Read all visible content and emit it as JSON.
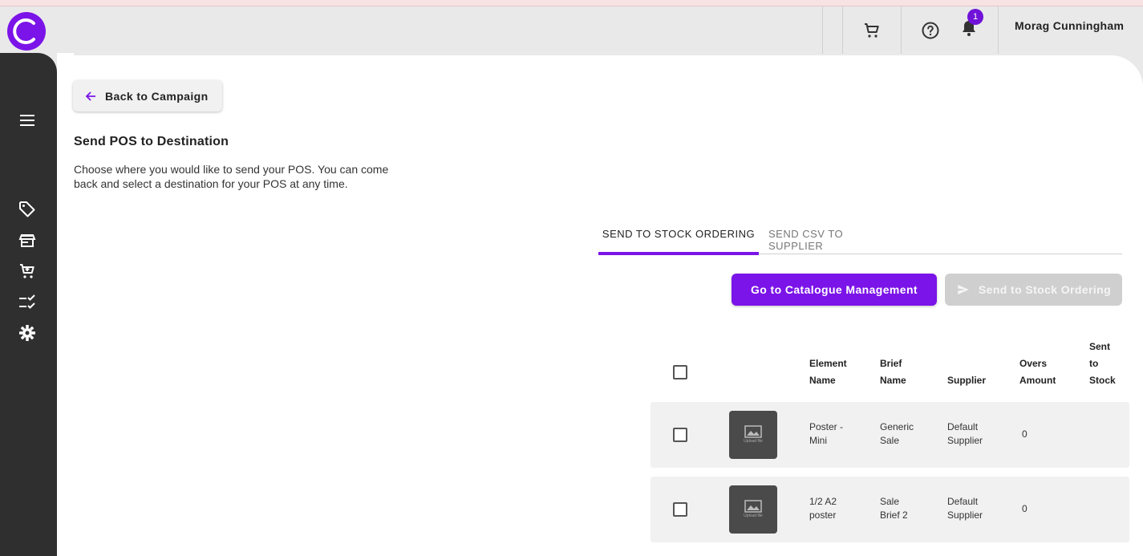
{
  "topbar": {
    "user_name": "Morag Cunningham",
    "notification_count": "1"
  },
  "back_button": {
    "label": "Back to Campaign"
  },
  "page": {
    "title": "Send POS to Destination",
    "description": "Choose where you would like to send your POS. You can come back and select a destination for your POS at any time."
  },
  "tabs": [
    {
      "label": "SEND TO STOCK ORDERING",
      "active": true
    },
    {
      "label": "SEND CSV TO SUPPLIER",
      "active": false
    }
  ],
  "actions": {
    "catalogue_label": "Go to Catalogue Management",
    "send_label": "Send to Stock Ordering"
  },
  "table": {
    "headers": {
      "element_name": [
        "Element",
        "Name"
      ],
      "brief_name": [
        "Brief",
        "Name"
      ],
      "supplier": "Supplier",
      "overs_amount": [
        "Overs",
        "Amount"
      ],
      "sent_to_stock": [
        "Sent",
        "to",
        "Stock"
      ]
    },
    "rows": [
      {
        "thumb_text": "Upload file",
        "element_name": [
          "Poster -",
          "Mini"
        ],
        "brief_name": [
          "Generic",
          "Sale"
        ],
        "supplier": [
          "Default",
          "Supplier"
        ],
        "overs_amount": "0",
        "sent_to_stock": ""
      },
      {
        "thumb_text": "Upload file",
        "element_name": [
          "1/2 A2",
          "poster"
        ],
        "brief_name": [
          "Sale",
          "Brief 2"
        ],
        "supplier": [
          "Default",
          "Supplier"
        ],
        "overs_amount": "0",
        "sent_to_stock": ""
      }
    ]
  },
  "colors": {
    "accent": "#7b14e8",
    "sidebar": "#2f2f2f",
    "disabled": "#cfcfcf"
  },
  "icons": {
    "logo": "c-logo-icon",
    "cart": "cart-icon",
    "help": "help-circle-icon",
    "bell": "bell-icon",
    "menu": "menu-icon",
    "tag": "tag-icon",
    "store": "store-icon",
    "orders": "cart-icon",
    "checklist": "checklist-icon",
    "settings": "gear-icon",
    "back": "arrow-left-icon",
    "send": "send-icon",
    "image": "image-icon"
  }
}
